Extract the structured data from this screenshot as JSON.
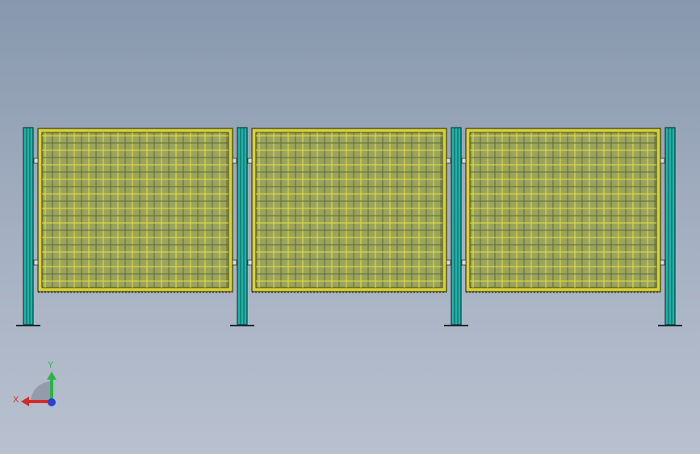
{
  "viewport": {
    "background_top": "#8797ad",
    "background_bottom": "#b9c1cf"
  },
  "model": {
    "panel_count": 3,
    "post_count": 4,
    "post_color": "#1fb3a8",
    "post_edge": "#0d3b39",
    "frame_color": "#d6d23a",
    "frame_edge": "#3c3a10",
    "mesh_fill": "#9aa45c",
    "mesh_wire_light": "#e8e23a",
    "mesh_wire_dark": "#5d6a3a"
  },
  "triad": {
    "x_label": "X",
    "y_label": "Y",
    "x_color": "#d42a2a",
    "y_color": "#2bb34a",
    "z_color": "#2a3fd4"
  }
}
